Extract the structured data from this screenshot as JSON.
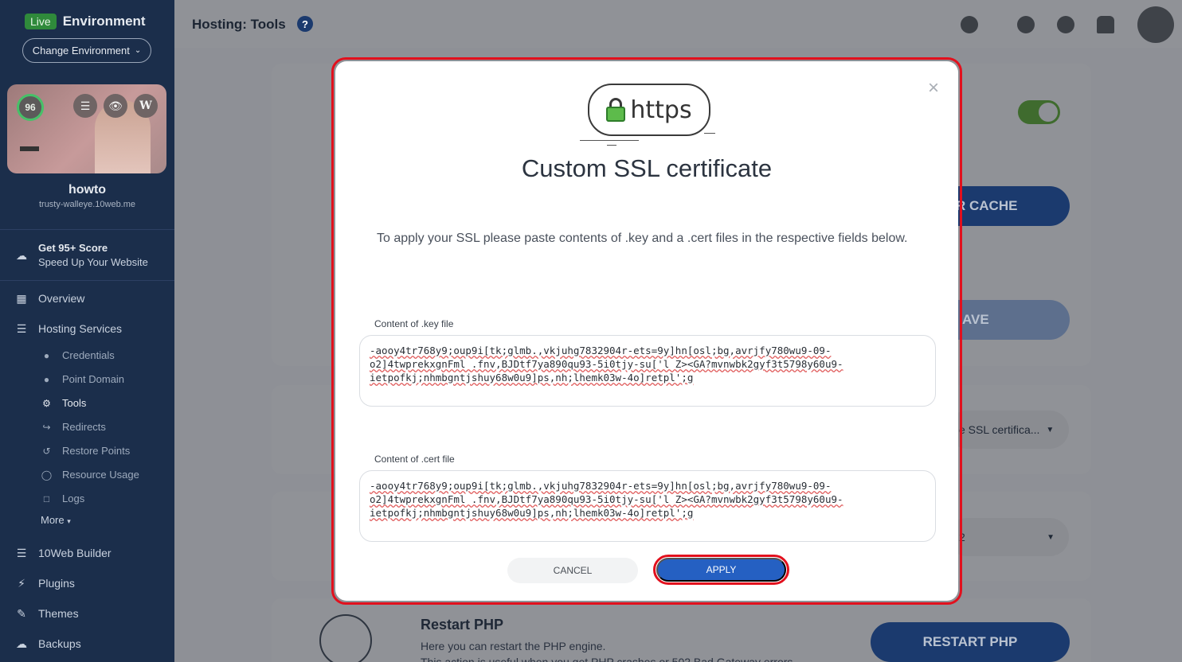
{
  "sidebar": {
    "live_badge": "Live",
    "environment_title": "Environment",
    "change_environment": "Change Environment",
    "site_score": "96",
    "site_name": "howto",
    "site_domain": "trusty-walleye.10web.me",
    "promo_title": "Get 95+ Score",
    "promo_subtitle": "Speed Up Your Website",
    "nav": {
      "overview": "Overview",
      "hosting_services": "Hosting Services",
      "builder": "10Web Builder",
      "plugins": "Plugins",
      "themes": "Themes",
      "backups": "Backups"
    },
    "sub": {
      "credentials": "Credentials",
      "point_domain": "Point Domain",
      "tools": "Tools",
      "redirects": "Redirects",
      "restore_points": "Restore Points",
      "resource_usage": "Resource Usage",
      "logs": "Logs"
    },
    "more": "More"
  },
  "header": {
    "title": "Hosting: Tools",
    "help": "?"
  },
  "background": {
    "clear_cache_partial": "R CACHE",
    "save_partial": "AVE",
    "ssl_select_partial": "e SSL certifica...",
    "php_select_partial": "2",
    "restart_title": "Restart PHP",
    "restart_desc": "Here you can restart the PHP engine.",
    "restart_desc2": "This action is useful when you get PHP crashes or 502 Bad Gateway errors.",
    "restart_button": "RESTART PHP"
  },
  "modal": {
    "badge_text": "https",
    "title": "Custom SSL certificate",
    "description": "To apply your SSL please paste contents of .key and a .cert files in the respective fields below.",
    "key_label": "Content of .key file",
    "key_value": "-aooy4tr768y9;oup9i[tk;glmb.,vkjuhg7832904r-ets=9y]hn[osl;bg,avrjfy780wu9-09-o2]4twprekxgnFml .fnv,BJDtf7ya890qu93-5i0tjy-su['l Z><GA?mvnwbk2gyf3t5798y60u9-ietpofkj;nhmbgntjshuy68w0u9]ps,nh;lhemk03w-4o]retpl';g",
    "cert_label": "Content of .cert file",
    "cert_value": "-aooy4tr768y9;oup9i[tk;glmb.,vkjuhg7832904r-ets=9y]hn[osl;bg,avrjfy780wu9-09-o2]4twprekxgnFml .fnv,BJDtf7ya890qu93-5i0tjy-su['l Z><GA?mvnwbk2gyf3t5798y60u9-ietpofkj;nhmbgntjshuy68w0u9]ps,nh;lhemk03w-4o]retpl';g",
    "cancel": "CANCEL",
    "apply": "APPLY",
    "close": "×"
  },
  "colors": {
    "sidebar_bg": "#1b2e4b",
    "primary": "#2560c2",
    "highlight": "#e2101d",
    "live_green": "#2f8a3b"
  }
}
